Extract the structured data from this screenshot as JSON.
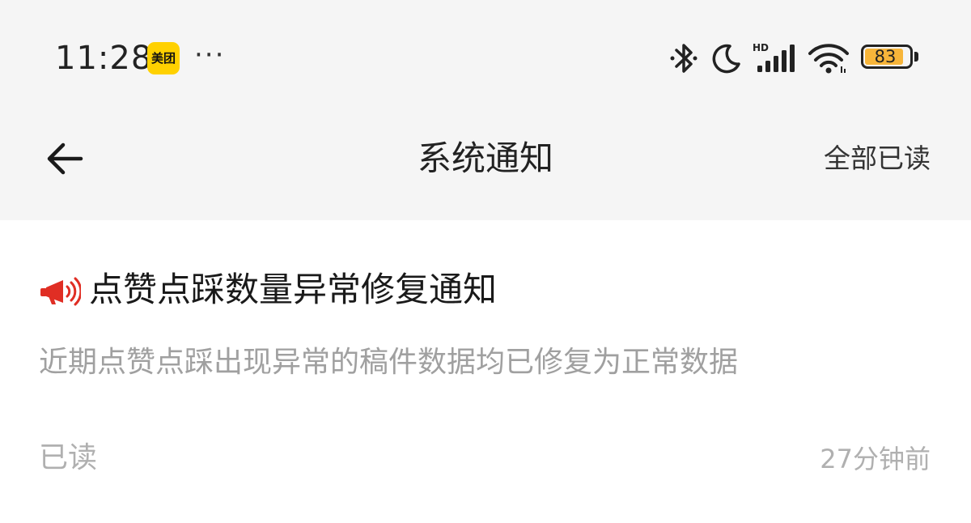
{
  "status_bar": {
    "time": "11:28",
    "app_badge_label": "美团",
    "more_label": "···",
    "battery_level": "83",
    "icons": [
      "bluetooth-icon",
      "moon-icon",
      "signal-hd-icon",
      "wifi-icon",
      "battery-icon"
    ],
    "battery_color": "#f7b53a"
  },
  "nav": {
    "title": "系统通知",
    "mark_all_read": "全部已读"
  },
  "notification": {
    "icon": "megaphone-icon",
    "icon_color": "#e02e24",
    "title": "点赞点踩数量异常修复通知",
    "body": "近期点赞点踩出现异常的稿件数据均已修复为正常数据",
    "read_status": "已读",
    "time": "27分钟前"
  }
}
